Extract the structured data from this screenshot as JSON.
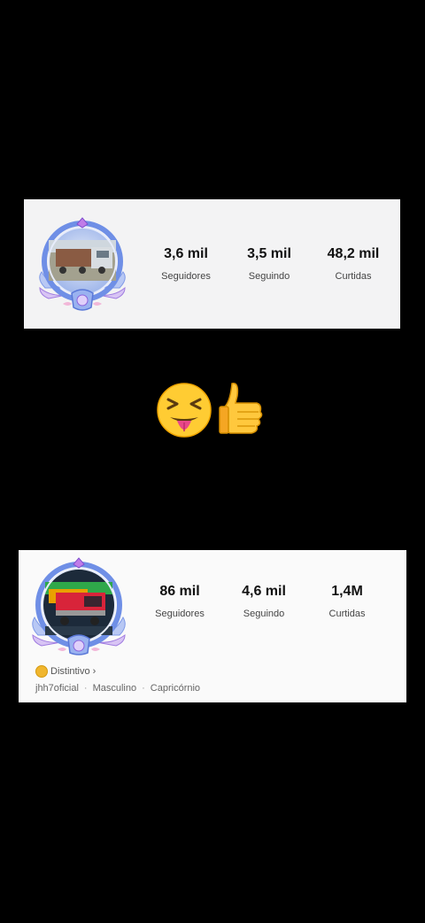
{
  "card_top": {
    "stats": [
      {
        "value": "3,6 mil",
        "label": "Seguidores"
      },
      {
        "value": "3,5 mil",
        "label": "Seguindo"
      },
      {
        "value": "48,2 mil",
        "label": "Curtidas"
      }
    ]
  },
  "card_bottom": {
    "stats": [
      {
        "value": "86 mil",
        "label": "Seguidores"
      },
      {
        "value": "4,6 mil",
        "label": "Seguindo"
      },
      {
        "value": "1,4M",
        "label": "Curtidas"
      }
    ],
    "badge_label": "Distintivo",
    "badge_chevron": "›",
    "info": {
      "username": "jhh7oficial",
      "separator": "·",
      "gender": "Masculino",
      "sign": "Capricórnio"
    }
  },
  "emojis": [
    "squinting-face-with-tongue-icon",
    "thumbs-up-icon"
  ],
  "colors": {
    "background": "#000000",
    "card": "#f3f3f4",
    "frame": "#6f8fe6",
    "frame_accent": "#c07ce8"
  }
}
